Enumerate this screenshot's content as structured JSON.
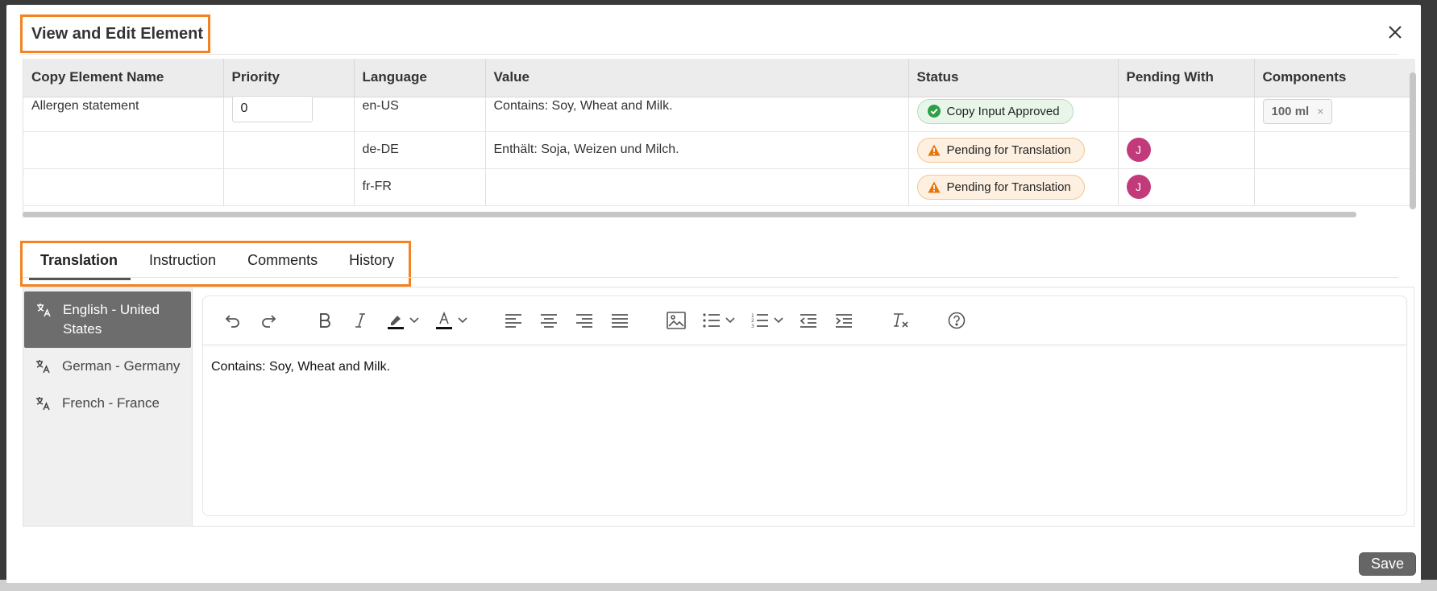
{
  "modal": {
    "title": "View and Edit Element",
    "save_label": "Save"
  },
  "table": {
    "columns": [
      "Copy Element Name",
      "Priority",
      "Language",
      "Value",
      "Status",
      "Pending With",
      "Components"
    ],
    "rows": [
      {
        "name": "Allergen statement",
        "priority": "0",
        "language": "en-US",
        "value": "Contains: Soy, Wheat and Milk.",
        "status": "Copy Input Approved",
        "pending_with": "",
        "component": "100 ml"
      },
      {
        "name": "",
        "priority": "",
        "language": "de-DE",
        "value": "Enthält: Soja, Weizen und Milch.",
        "status": "Pending for Translation",
        "pending_with": "J",
        "component": ""
      },
      {
        "name": "",
        "priority": "",
        "language": "fr-FR",
        "value": "",
        "status": "Pending for Translation",
        "pending_with": "J",
        "component": ""
      }
    ],
    "status_colors": {
      "approved": "#2e9e44",
      "pending": "#e8740c"
    },
    "avatar_color": "#c33a7b",
    "chip_remove": "×"
  },
  "tabs": [
    "Translation",
    "Instruction",
    "Comments",
    "History"
  ],
  "languages": [
    "English - United States",
    "German - Germany",
    "French - France"
  ],
  "editor": {
    "content": "Contains: Soy, Wheat and Milk.",
    "toolbar_icons": [
      "undo-icon",
      "redo-icon",
      "bold-icon",
      "italic-icon",
      "highlight-icon",
      "font-color-icon",
      "align-left-icon",
      "align-center-icon",
      "align-right-icon",
      "justify-icon",
      "image-icon",
      "bullet-list-icon",
      "numbered-list-icon",
      "outdent-icon",
      "indent-icon",
      "clear-format-icon",
      "help-icon"
    ]
  },
  "accent_color": "#f58220"
}
